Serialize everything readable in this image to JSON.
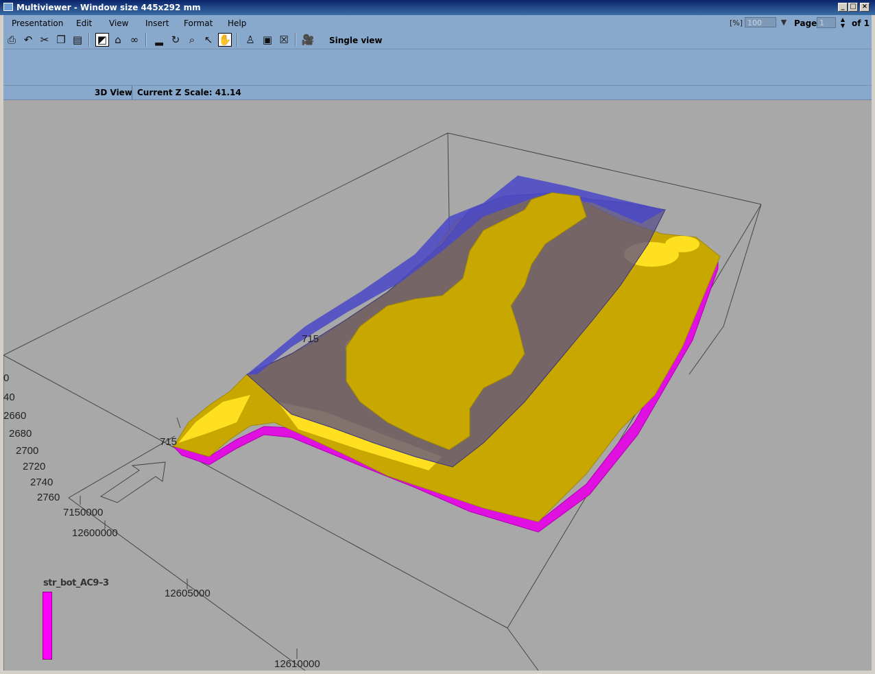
{
  "window": {
    "title": "Multiviewer - Window size 445x292 mm",
    "controls": {
      "minimize": "_",
      "maximize": "□",
      "close": "×"
    }
  },
  "menubar": {
    "items": [
      "Presentation",
      "Edit",
      "View",
      "Insert",
      "Format",
      "Help"
    ],
    "zoom_unit": "[%]",
    "zoom_value": "100",
    "page_label": "Page",
    "page_value": "1",
    "of_label": "of 1"
  },
  "toolbar": {
    "icons": [
      "print-icon",
      "undo-icon",
      "cut-icon",
      "copy-icon",
      "paste-icon",
      "select-frame-icon",
      "home-icon",
      "glasses-icon",
      "ruler-icon",
      "rotate-icon",
      "zoom-icon",
      "pointer-icon",
      "pan-hand-icon",
      "bucket-icon",
      "frame-icon",
      "delete-frame-icon",
      "camera-icon"
    ],
    "single_view_label": "Single view"
  },
  "statusbar": {
    "view_name": "3D View",
    "zscale_label": "Current Z Scale:  41.14"
  },
  "scene": {
    "z_tick_labels": [
      "0",
      "40",
      "2660",
      "2680",
      "2700",
      "2720",
      "2740",
      "2760"
    ],
    "y_tick_labels": [
      "7150000",
      "715",
      "715"
    ],
    "x_tick_labels": [
      "12600000",
      "12605000",
      "12610000"
    ],
    "colors": {
      "background": "#a8a8a8",
      "yellow_surface": "#c8a800",
      "yellow_highlight": "#ffe020",
      "purple_plane": "#5a4f8a",
      "blue_plane": "#4a48c8",
      "magenta_bottom": "#e010e0"
    }
  },
  "legend": {
    "title": "str_bot_AC9–3",
    "color": "#ff00ff"
  }
}
